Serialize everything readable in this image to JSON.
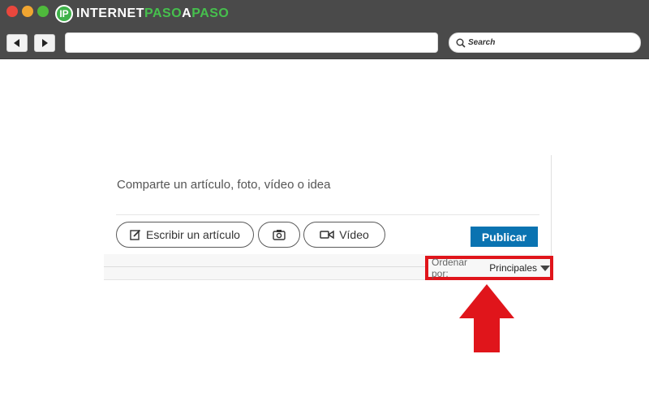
{
  "browser": {
    "logo_part1": "INTERNET",
    "logo_part2": "PASO",
    "logo_part3": "A",
    "logo_part4": "PASO",
    "logo_mark": "IP",
    "search_label": "Search"
  },
  "composer": {
    "placeholder": "Comparte un artículo, foto, vídeo o idea",
    "write_article": "Escribir un artículo",
    "video": "Vídeo",
    "publish": "Publicar"
  },
  "feed": {
    "sort_label": "Ordenar por:",
    "sort_value": "Principales"
  },
  "colors": {
    "highlight": "#e0151b",
    "publish": "#0a73b1",
    "brand_green": "#46c04d"
  },
  "icons": [
    "edit-icon",
    "camera-icon",
    "video-icon",
    "search-icon",
    "back-icon",
    "forward-icon",
    "dropdown-caret-icon",
    "arrow-up-icon"
  ]
}
